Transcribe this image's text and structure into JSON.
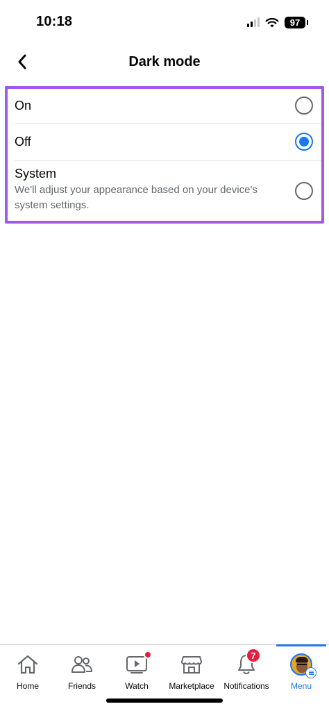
{
  "status_bar": {
    "time": "10:18",
    "battery": "97",
    "icons": [
      "signal-icon",
      "wifi-icon",
      "battery-icon"
    ]
  },
  "header": {
    "back_icon": "chevron-left-icon",
    "title": "Dark mode"
  },
  "options": [
    {
      "label": "On",
      "description": "",
      "selected": false
    },
    {
      "label": "Off",
      "description": "",
      "selected": true
    },
    {
      "label": "System",
      "description": "We'll adjust your appearance based on your device's system settings.",
      "selected": false
    }
  ],
  "highlight_color": "#a259e8",
  "accent_color": "#1877f2",
  "tab_bar": {
    "tabs": [
      {
        "label": "Home",
        "icon": "home-icon"
      },
      {
        "label": "Friends",
        "icon": "friends-icon"
      },
      {
        "label": "Watch",
        "icon": "watch-icon",
        "has_dot": true
      },
      {
        "label": "Marketplace",
        "icon": "marketplace-icon"
      },
      {
        "label": "Notifications",
        "icon": "bell-icon",
        "badge": "7"
      },
      {
        "label": "Menu",
        "icon": "avatar-menu-icon",
        "active": true
      }
    ]
  }
}
